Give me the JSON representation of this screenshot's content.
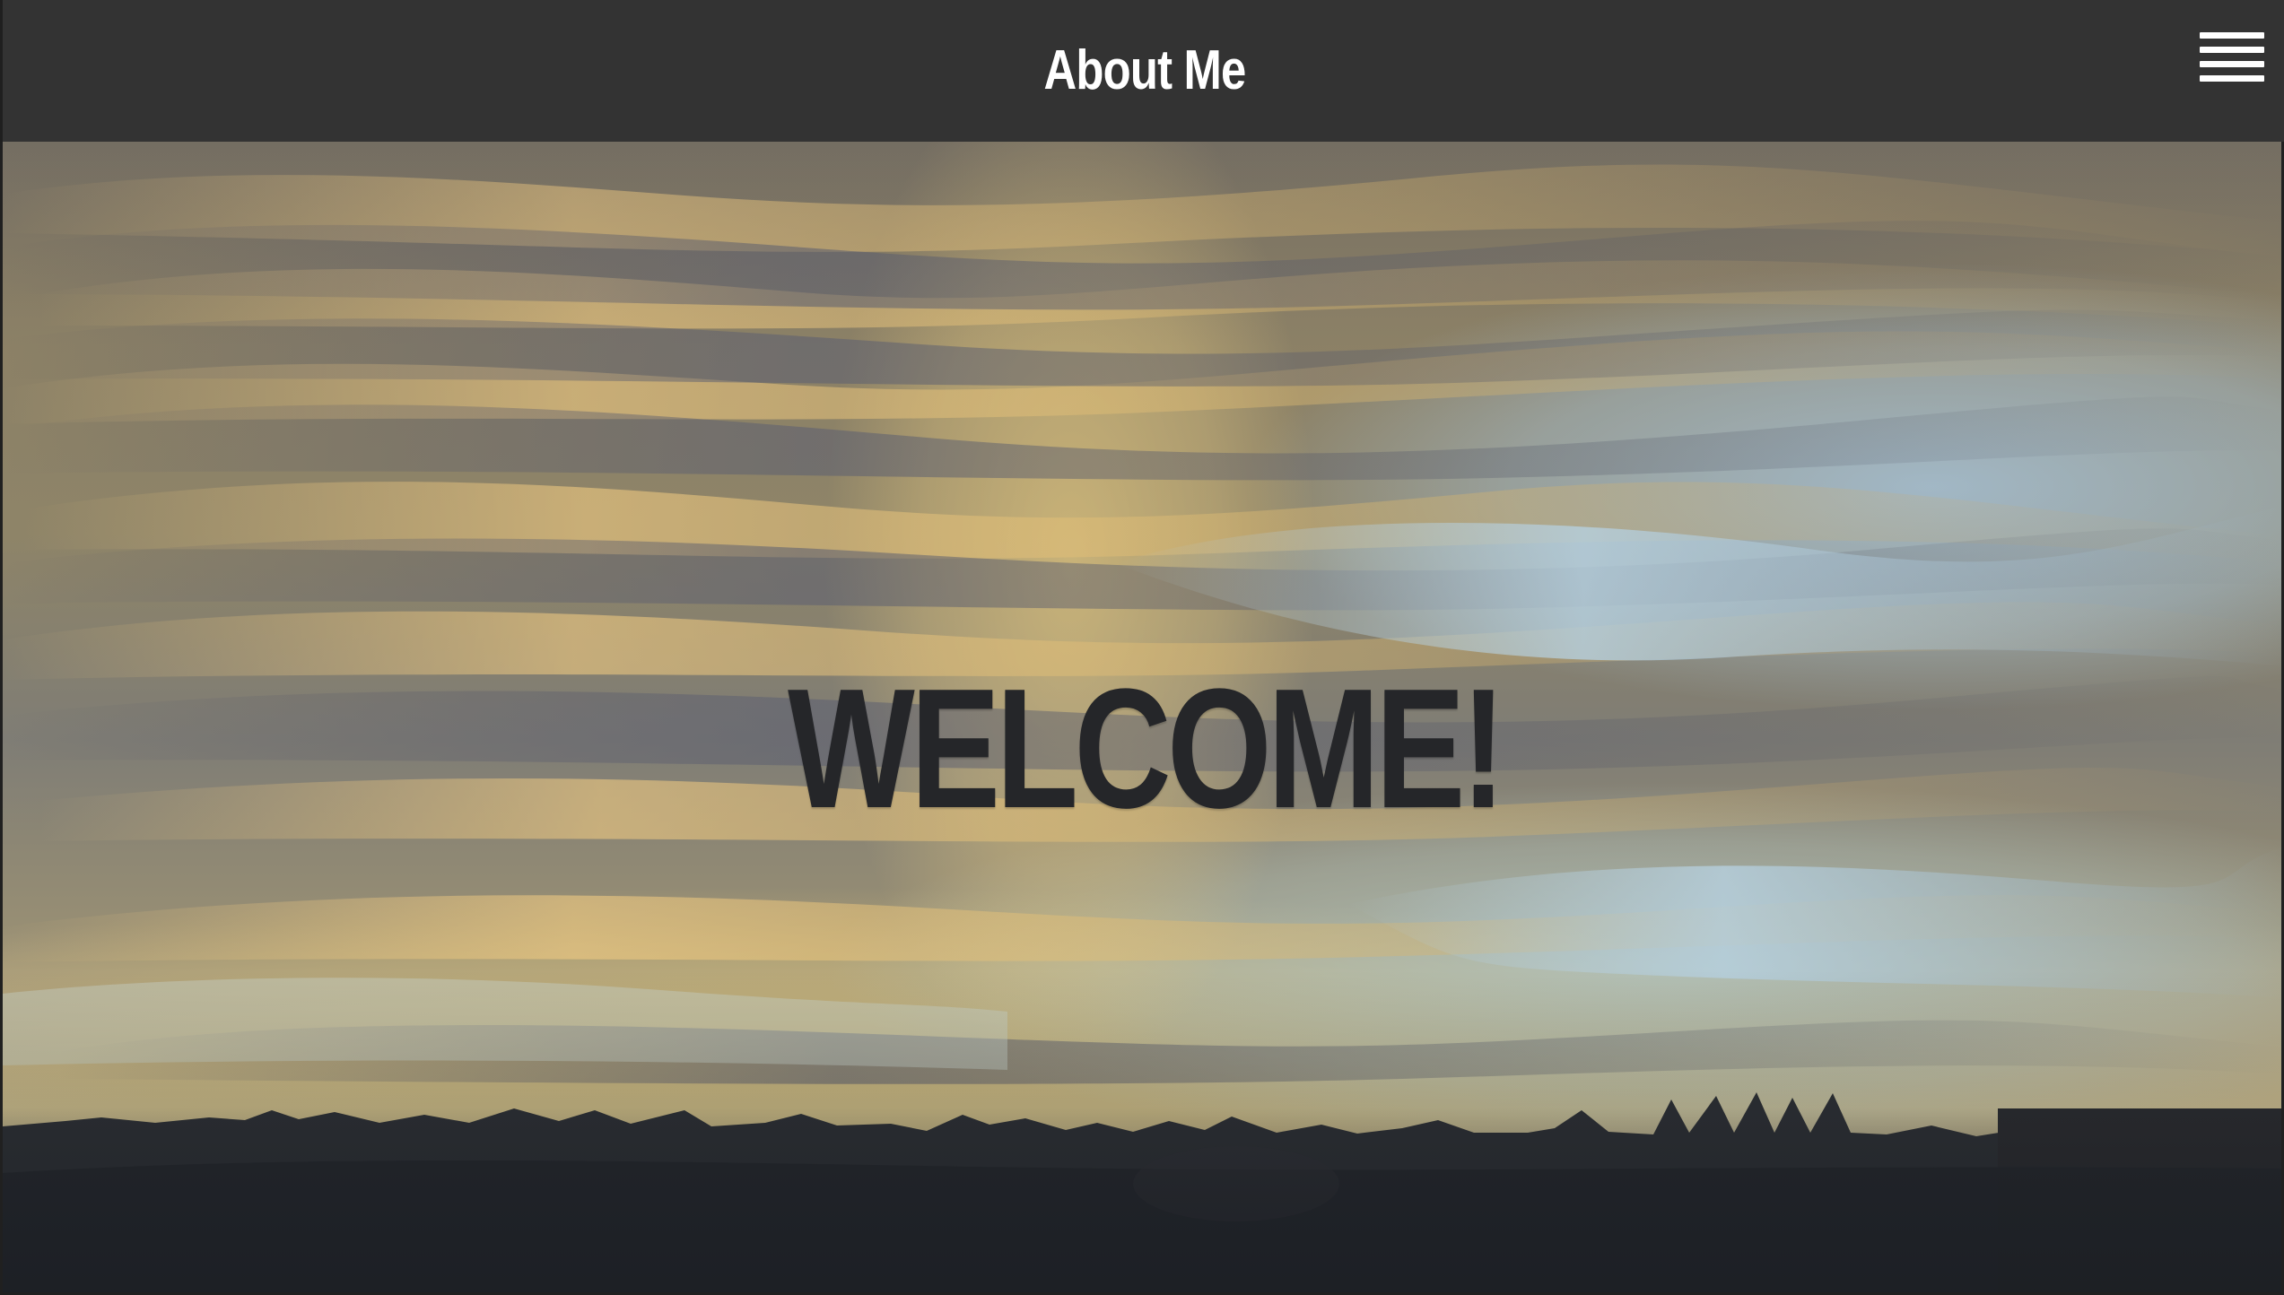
{
  "header": {
    "title": "About Me",
    "menu_icon": "hamburger-menu-icon"
  },
  "hero": {
    "heading": "WELCOME!",
    "image": "sunset-sky-over-tree-silhouettes"
  },
  "colors": {
    "header_background": "#333333",
    "header_text": "#ffffff",
    "heading_text": "#252629",
    "sky_gold": "#d8bd7c",
    "sky_blue": "#a9c5d8",
    "ground_silhouette": "#2d3035"
  }
}
